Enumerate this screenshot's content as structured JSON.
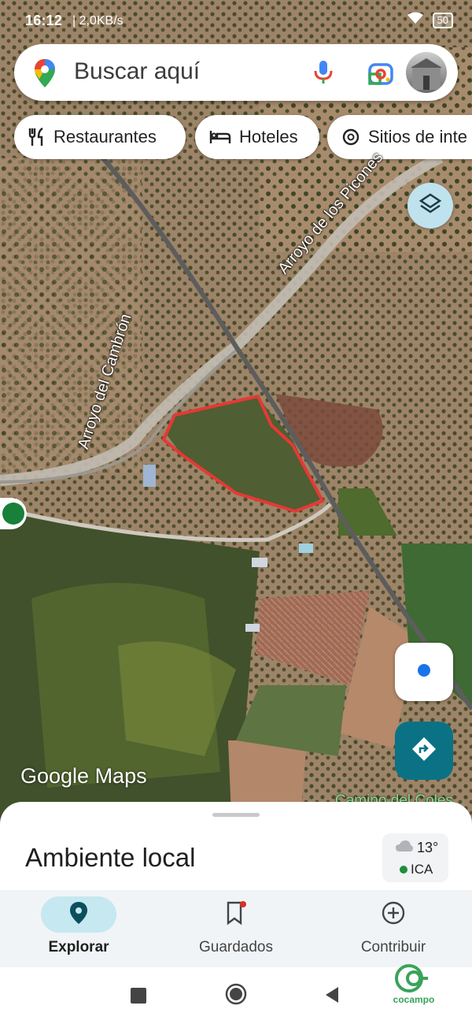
{
  "status_bar": {
    "time": "16:12",
    "network_rate": "| 2,0KB/s",
    "battery": "50"
  },
  "search": {
    "placeholder": "Buscar aquí",
    "icons": [
      "maps-pin-icon",
      "microphone-icon",
      "lens-icon",
      "profile-avatar"
    ]
  },
  "chips": [
    {
      "label": "Restaurantes",
      "icon": "fork-knife-icon"
    },
    {
      "label": "Hoteles",
      "icon": "bed-icon"
    },
    {
      "label": "Sitios de inte",
      "icon": "camera-icon"
    }
  ],
  "map": {
    "labels": {
      "stream_1": "Arroyo de los Picones",
      "stream_2": "Arroyo del Cambrón",
      "road": "Camino del Coles"
    },
    "wordmark": "Google Maps",
    "colors": {
      "boundary": "#e53935",
      "location_dot": "#1a73e8",
      "directions_button": "#0b7285"
    }
  },
  "sheet": {
    "title": "Ambiente local",
    "weather": {
      "temperature": "13°",
      "air_quality": "ICA"
    }
  },
  "bottom_nav": [
    {
      "label": "Explorar",
      "active": true
    },
    {
      "label": "Guardados",
      "active": false,
      "badge": true
    },
    {
      "label": "Contribuir",
      "active": false
    }
  ],
  "brand": {
    "name": "cocampo"
  }
}
